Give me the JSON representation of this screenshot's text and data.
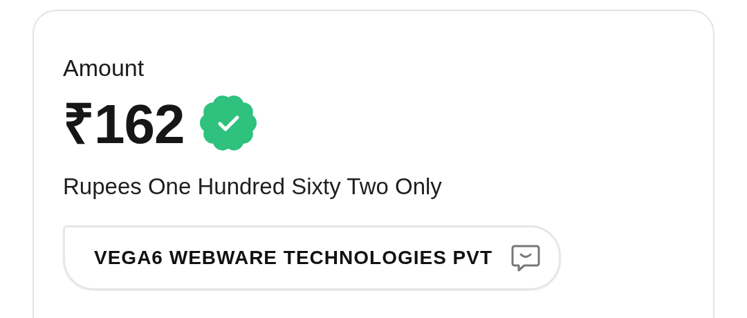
{
  "card": {
    "label": "Amount",
    "amount": "₹162",
    "verified": true,
    "amount_in_words": "Rupees One Hundred Sixty Two Only",
    "payee": "VEGA6 WEBWARE TECHNOLOGIES PVT"
  }
}
